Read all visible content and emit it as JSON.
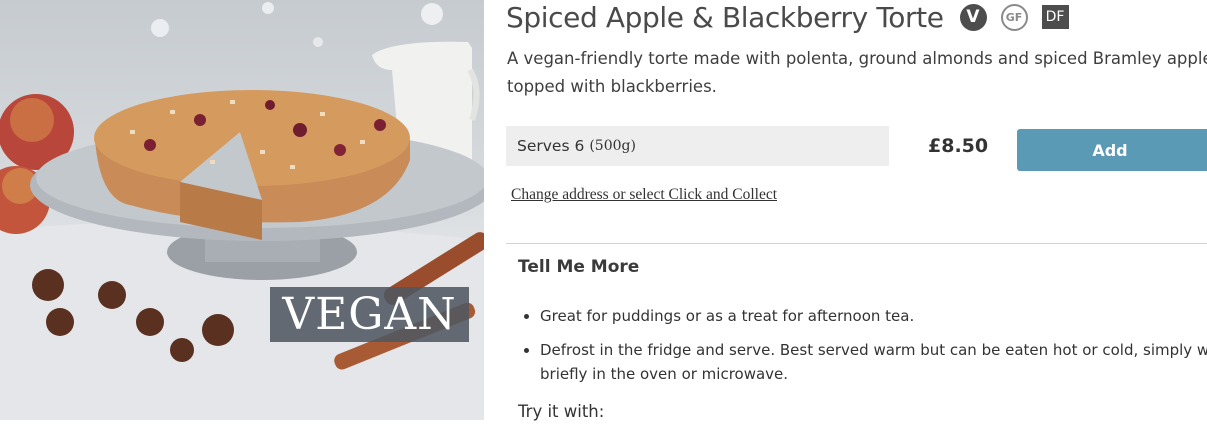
{
  "product": {
    "title": "Spiced Apple & Blackberry Torte",
    "badges": [
      {
        "icon": "vegetarian-icon",
        "text": "V"
      },
      {
        "icon": "gluten-free-icon",
        "text": "GF"
      },
      {
        "icon": "dairy-free-icon",
        "text": "DF"
      }
    ],
    "description_line1": "A vegan-friendly torte made with polenta, ground almonds and spiced Bramley apple,",
    "description_line2": "topped with blackberries.",
    "image_overlay": "VEGAN"
  },
  "purchase": {
    "variant_label": "Serves 6",
    "variant_weight": "(500g)",
    "price": "£8.50",
    "add_label": "Add",
    "address_link": "Change address or select Click and Collect"
  },
  "details": {
    "heading": "Tell Me More",
    "bullets": [
      {
        "line1": "Great for puddings or as a treat for afternoon tea.",
        "line2": ""
      },
      {
        "line1": "Defrost in the fridge and serve. Best served warm but can be eaten hot or cold, simply warm",
        "line2": "briefly in the oven or microwave."
      }
    ],
    "try_label": "Try it with:"
  },
  "colors": {
    "accent_button": "#5b9ab5",
    "badge_dark": "#4d4d4d"
  }
}
